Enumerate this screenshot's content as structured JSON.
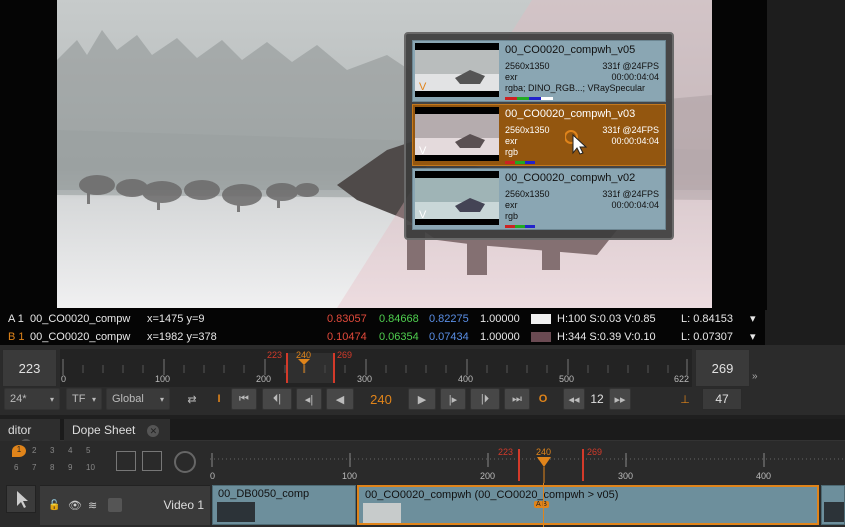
{
  "viewer": {
    "popup": {
      "versions": [
        {
          "name": "00_CO0020_compwh_v05",
          "res": "2560x1350",
          "frames": "331f @24FPS",
          "format": "exr",
          "tc": "00:00:04:04",
          "channels": "rgba; DINO_RGB...; VRaySpecular",
          "letter": "V",
          "selected": false
        },
        {
          "name": "00_CO0020_compwh_v03",
          "res": "2560x1350",
          "frames": "331f @24FPS",
          "format": "exr",
          "tc": "00:00:04:04",
          "channels": "rgb",
          "letter": "V",
          "selected": true
        },
        {
          "name": "00_CO0020_compwh_v02",
          "res": "2560x1350",
          "frames": "331f @24FPS",
          "format": "exr",
          "tc": "00:00:04:04",
          "channels": "rgb",
          "letter": "V",
          "selected": false
        }
      ]
    },
    "info": {
      "a": {
        "label": "A 1",
        "name": "00_CO0020_compw",
        "coords": "x=1475 y=9",
        "r": "0.83057",
        "g": "0.84668",
        "b": "0.82275",
        "a": "1.00000",
        "hsv": "H:100 S:0.03 V:0.85",
        "l": "L: 0.84153",
        "swatch": "#f0f0f0"
      },
      "b": {
        "label": "B 1",
        "name": "00_CO0020_compw",
        "coords": "x=1982 y=378",
        "r": "0.10474",
        "g": "0.06354",
        "b": "0.07434",
        "a": "1.00000",
        "hsv": "H:344 S:0.39 V:0.10",
        "l": "L: 0.07307",
        "swatch": "#6a4a52"
      }
    }
  },
  "timebar": {
    "in_frame": "223",
    "out_frame": "269",
    "in_marker": "223",
    "current_marker": "240",
    "out_marker": "269",
    "ruler_ticks": [
      "0",
      "100",
      "200",
      "300",
      "400",
      "500",
      "622"
    ],
    "fps": "24*",
    "tf": "TF",
    "scope": "Global",
    "current_frame": "240",
    "step": "12",
    "end_frame": "47"
  },
  "tabs": [
    {
      "label": "ditor"
    },
    {
      "label": "Dope Sheet"
    }
  ],
  "dope": {
    "markers": {
      "in": "223",
      "current": "240",
      "out": "269"
    },
    "ruler_ticks": [
      "0",
      "100",
      "200",
      "300",
      "400"
    ],
    "layer_buttons": [
      "2",
      "3",
      "4",
      "5",
      "6",
      "7",
      "8",
      "9",
      "10"
    ],
    "marker_button": "1",
    "track_name": "Video 1",
    "clips": [
      {
        "label": "00_DB0050_comp"
      },
      {
        "label": "00_CO0020_compwh (00_CO0020_compwh > v05)",
        "ab": "A B"
      }
    ]
  },
  "colors": {
    "accent": "#e0841a",
    "red_value": "#e24a3b",
    "green_value": "#4fcf4f",
    "blue_value": "#5a8fe6",
    "in_out_marker": "#d33a2a"
  }
}
